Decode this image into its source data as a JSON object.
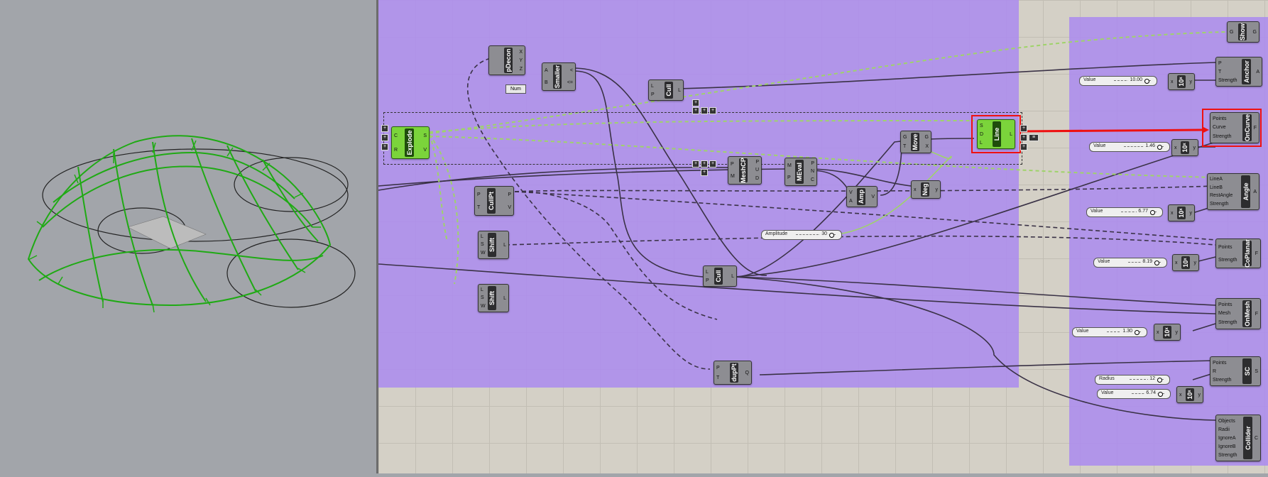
{
  "components": {
    "explode": {
      "title": "Explode",
      "inputs": [
        "C",
        "R"
      ],
      "outputs": [
        "S",
        "V"
      ]
    },
    "pdecon": {
      "title": "pDecon",
      "inputs": [
        ""
      ],
      "outputs": [
        "X",
        "Y",
        "Z"
      ]
    },
    "smaller": {
      "title": "Smaller",
      "inputs": [
        "A",
        "B"
      ],
      "outputs": [
        "<",
        "<="
      ]
    },
    "num": {
      "title": "Num"
    },
    "cull_top": {
      "title": "Cull",
      "inputs": [
        "L",
        "P"
      ],
      "outputs": [
        "L"
      ]
    },
    "cullpt": {
      "title": "CullPt",
      "inputs": [
        "P",
        "T"
      ],
      "outputs": [
        "P",
        "V"
      ]
    },
    "shift1": {
      "title": "Shift",
      "inputs": [
        "L",
        "S",
        "W"
      ],
      "outputs": [
        "L"
      ]
    },
    "shift2": {
      "title": "Shift",
      "inputs": [
        "L",
        "S",
        "W"
      ],
      "outputs": [
        "L"
      ]
    },
    "meshcp": {
      "title": "MeshCP",
      "inputs": [
        "P",
        "M"
      ],
      "outputs": [
        "P",
        "U",
        "D"
      ]
    },
    "meval": {
      "title": "MEval",
      "inputs": [
        "M",
        "P"
      ],
      "outputs": [
        "P",
        "N",
        "C"
      ]
    },
    "amp": {
      "title": "Amp",
      "inputs": [
        "V",
        "A"
      ],
      "outputs": [
        "V"
      ]
    },
    "neg": {
      "title": "Neg",
      "inputs": [
        "x"
      ],
      "outputs": [
        "y"
      ]
    },
    "move": {
      "title": "Move",
      "inputs": [
        "G",
        "T"
      ],
      "outputs": [
        "G",
        "X"
      ]
    },
    "line": {
      "title": "Line",
      "inputs": [
        "S",
        "D",
        "L"
      ],
      "outputs": [
        "L"
      ]
    },
    "cull_mid": {
      "title": "Cull",
      "inputs": [
        "L",
        "P"
      ],
      "outputs": [
        "L"
      ]
    },
    "duppt": {
      "title": "dupPt",
      "inputs": [
        "P",
        "T"
      ],
      "outputs": [
        "Q"
      ]
    },
    "show": {
      "title": "Show",
      "inputs": [
        "G"
      ],
      "outputs": [
        "G"
      ]
    },
    "anchor": {
      "title": "Anchor",
      "inputs": [
        "P",
        "T",
        "Strength"
      ],
      "outputs": [
        "A"
      ]
    },
    "oncurve": {
      "title": "OnCurve",
      "inputs": [
        "Points",
        "Curve",
        "Strength"
      ],
      "outputs": [
        "F"
      ]
    },
    "angle": {
      "title": "Angle",
      "inputs": [
        "LineA",
        "LineB",
        "RestAngle",
        "Strength"
      ],
      "outputs": [
        "A"
      ]
    },
    "coplanar": {
      "title": "CoPlanar",
      "inputs": [
        "Points",
        "Strength"
      ],
      "outputs": [
        "F"
      ]
    },
    "onmesh": {
      "title": "OnMesh",
      "inputs": [
        "Points",
        "Mesh",
        "Strength"
      ],
      "outputs": [
        "F"
      ]
    },
    "sc": {
      "title": "SC",
      "inputs": [
        "Points",
        "R",
        "Strength"
      ],
      "outputs": [
        "S"
      ]
    },
    "collider": {
      "title": "Collider",
      "inputs": [
        "Objects",
        "Radii",
        "IgnoreA",
        "IgnoreB",
        "Strength"
      ],
      "outputs": [
        "C"
      ]
    },
    "pow1": {
      "title": "10ˣ",
      "inputs": [
        "x"
      ],
      "outputs": [
        "y"
      ]
    },
    "pow2": {
      "title": "10ˣ",
      "inputs": [
        "x"
      ],
      "outputs": [
        "y"
      ]
    },
    "pow3": {
      "title": "10ˣ",
      "inputs": [
        "x"
      ],
      "outputs": [
        "y"
      ]
    },
    "pow4": {
      "title": "10ˣ",
      "inputs": [
        "x"
      ],
      "outputs": [
        "y"
      ]
    },
    "pow5": {
      "title": "10ˣ",
      "inputs": [
        "x"
      ],
      "outputs": [
        "y"
      ]
    },
    "pow6": {
      "title": "10ˣ",
      "inputs": [
        "x"
      ],
      "outputs": [
        "y"
      ]
    }
  },
  "sliders": {
    "anchor_value": {
      "label": "Value",
      "value": "10.00"
    },
    "oncurve_value": {
      "label": "Value",
      "value": "1.46"
    },
    "angle_value": {
      "label": "Value",
      "value": "6.77"
    },
    "coplanar_value": {
      "label": "Value",
      "value": "8.19"
    },
    "onmesh_value": {
      "label": "Value",
      "value": "1.30"
    },
    "radius": {
      "label": "Radius",
      "value": "12"
    },
    "sc_value": {
      "label": "Value",
      "value": "6.74"
    },
    "amplitude": {
      "label": "Amplitude",
      "value": "30"
    }
  },
  "colors": {
    "group_fill": "#ac8cee",
    "canvas_bg": "#d4d0c6",
    "viewport_bg": "#a2a5aa",
    "selection": "#ee1111",
    "active_component": "#7bd43b",
    "preview_mesh": "#1faa14"
  }
}
